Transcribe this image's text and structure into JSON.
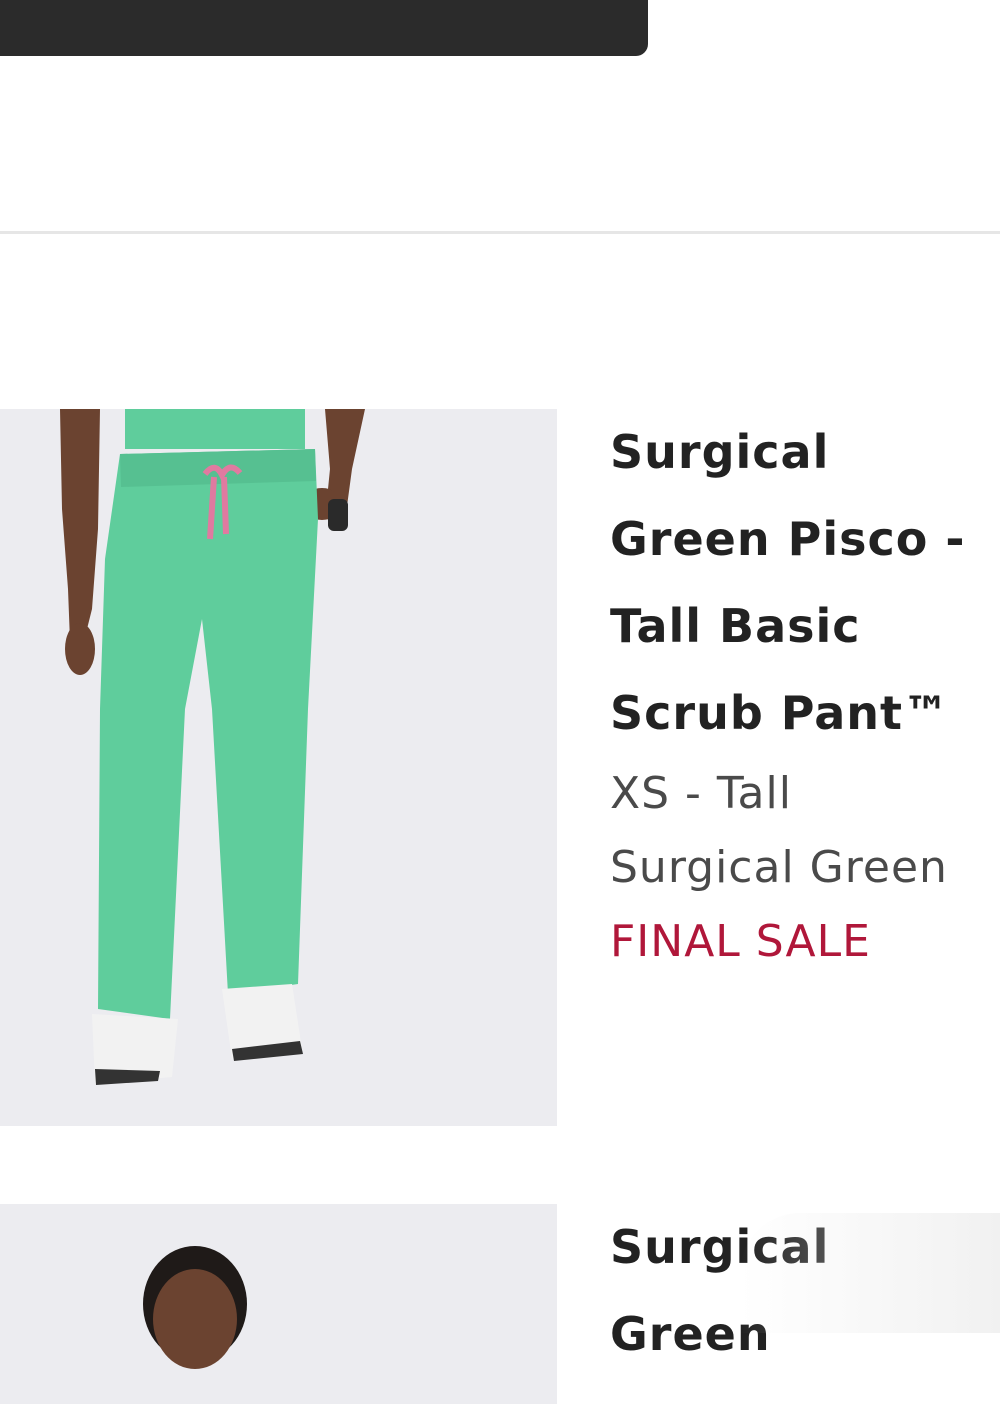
{
  "items": [
    {
      "title_lines": [
        "Surgical",
        "Green Pisco -",
        "Tall Basic",
        "Scrub Pant™"
      ],
      "size": "XS - Tall",
      "color": "Surgical Green",
      "badge": "FINAL SALE"
    },
    {
      "title_lines": [
        "Surgical",
        "Green"
      ]
    }
  ],
  "colors": {
    "top_bar": "#2b2b2b",
    "badge": "#b0173a",
    "scrubs": "#5fcd9c"
  }
}
